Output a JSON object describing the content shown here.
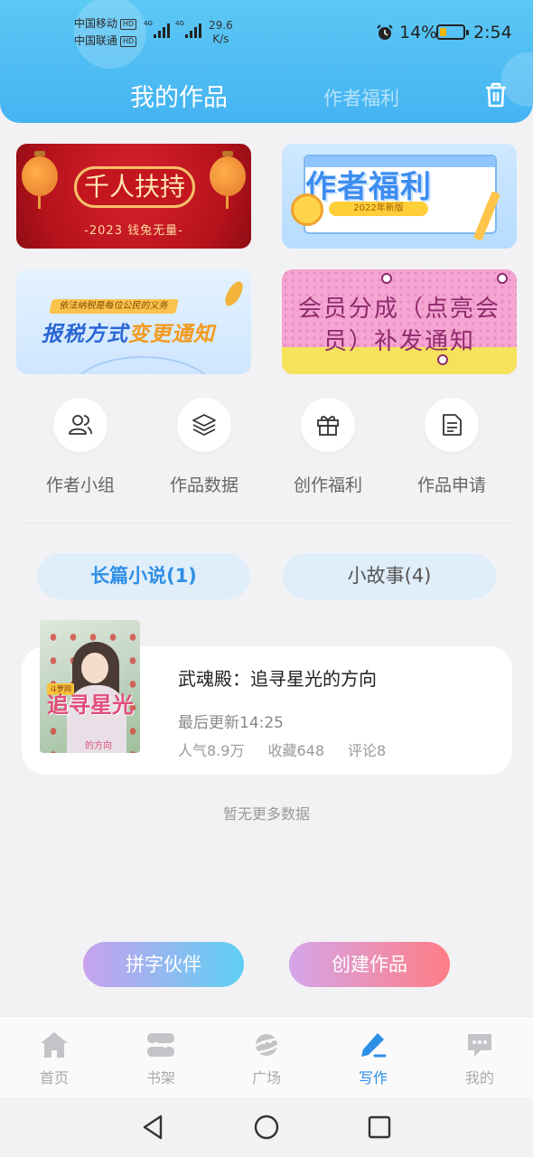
{
  "status_bar": {
    "carrier1": "中国移动",
    "carrier2": "中国联通",
    "hd": "HD",
    "net": "4G",
    "speed_value": "29.6",
    "speed_unit": "K/s",
    "battery": "14%",
    "battery_level": 0.14,
    "time": "2:54"
  },
  "header": {
    "tab_active": "我的作品",
    "tab_inactive": "作者福利",
    "trash_icon": "trash-icon"
  },
  "banners": {
    "b1": {
      "title": "千人扶持",
      "subtitle": "-2023 钱兔无量-"
    },
    "b2": {
      "title": "作者福利",
      "pill": "2022年新版"
    },
    "b3": {
      "caption": "依法纳税是每位公民的义务",
      "title_main": "报税方式",
      "title_highlight": "变更通知"
    },
    "b4": {
      "title_line1": "会员分成（点亮会",
      "title_line2": "员）补发通知"
    }
  },
  "quick_links": [
    {
      "label": "作者小组",
      "icon": "users-icon"
    },
    {
      "label": "作品数据",
      "icon": "layers-icon"
    },
    {
      "label": "创作福利",
      "icon": "gift-icon"
    },
    {
      "label": "作品申请",
      "icon": "document-icon"
    }
  ],
  "segments": {
    "novel": "长篇小说(1)",
    "story": "小故事(4)"
  },
  "work": {
    "title": "武魂殿：追寻星光的方向",
    "updated": "最后更新14:25",
    "popularity": "人气8.9万",
    "favorites": "收藏648",
    "comments": "评论8",
    "cover": {
      "badge": "斗罗同",
      "title": "追寻星光",
      "subtitle": "的方向"
    }
  },
  "no_more": "暂无更多数据",
  "actions": {
    "partner": "拼字伙伴",
    "create": "创建作品"
  },
  "bottom_nav": [
    {
      "label": "首页",
      "icon": "home-icon"
    },
    {
      "label": "书架",
      "icon": "bookshelf-icon"
    },
    {
      "label": "广场",
      "icon": "planet-icon"
    },
    {
      "label": "写作",
      "icon": "pen-icon",
      "active": true
    },
    {
      "label": "我的",
      "icon": "chat-icon"
    }
  ],
  "colors": {
    "accent": "#2f8fe6",
    "header": "#44b3f2"
  }
}
